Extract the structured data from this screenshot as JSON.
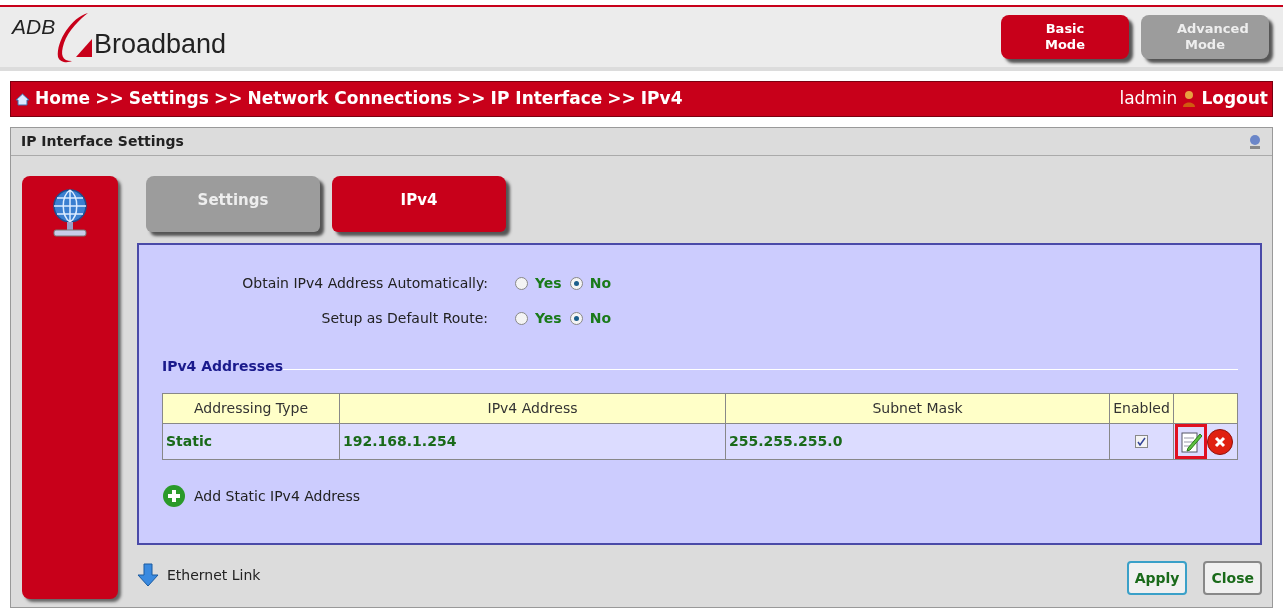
{
  "header": {
    "logo_top": "ADB",
    "logo_bottom": "Broadband",
    "modes": [
      {
        "label": "Basic Mode",
        "selected": true
      },
      {
        "label": "Advanced Mode",
        "selected": false
      }
    ]
  },
  "breadcrumb": {
    "items": [
      "Home",
      "Settings",
      "Network Connections",
      "IP Interface",
      "IPv4"
    ],
    "separator": ">>",
    "user": "ladmin",
    "logout": "Logout"
  },
  "panel": {
    "title": "IP Interface Settings",
    "tabs": [
      {
        "label": "Settings",
        "selected": false
      },
      {
        "label": "IPv4",
        "selected": true
      }
    ],
    "options": [
      {
        "label": "Obtain IPv4 Address Automatically:",
        "choices": [
          {
            "label": "Yes",
            "selected": false
          },
          {
            "label": "No",
            "selected": true
          }
        ]
      },
      {
        "label": "Setup as Default Route:",
        "choices": [
          {
            "label": "Yes",
            "selected": false
          },
          {
            "label": "No",
            "selected": true
          }
        ]
      }
    ],
    "section_title": "IPv4 Addresses",
    "table": {
      "columns": [
        "Addressing Type",
        "IPv4 Address",
        "Subnet Mask",
        "Enabled"
      ],
      "rows": [
        {
          "type": "Static",
          "address": "192.168.1.254",
          "mask": "255.255.255.0",
          "enabled": true,
          "edit_highlighted": true
        }
      ]
    },
    "add_link": "Add Static IPv4 Address",
    "footer_link": "Ethernet Link",
    "buttons": [
      "Apply",
      "Close"
    ]
  }
}
